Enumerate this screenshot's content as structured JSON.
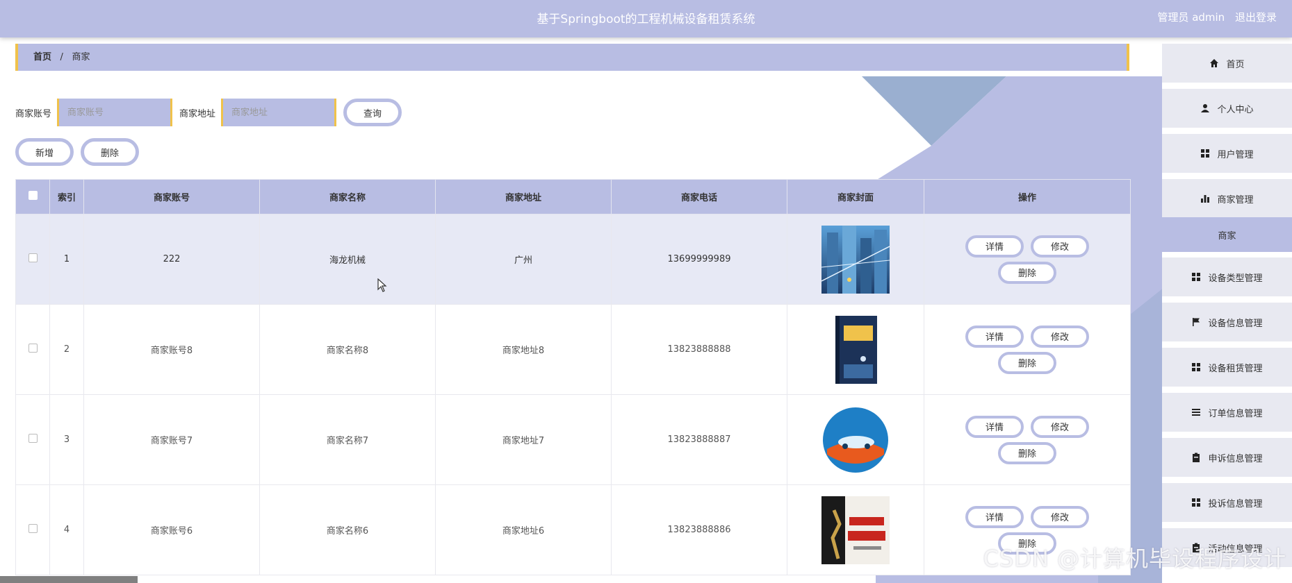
{
  "header": {
    "title": "基于Springboot的工程机械设备租赁系统",
    "role_user": "管理员 admin",
    "logout": "退出登录"
  },
  "breadcrumb": {
    "home": "首页",
    "sep": "/",
    "current": "商家"
  },
  "search": {
    "account_label": "商家账号",
    "account_placeholder": "商家账号",
    "address_label": "商家地址",
    "address_placeholder": "商家地址",
    "query_button": "查询"
  },
  "actions": {
    "add": "新增",
    "delete": "删除"
  },
  "table": {
    "columns": [
      "索引",
      "商家账号",
      "商家名称",
      "商家地址",
      "商家电话",
      "商家封面",
      "操作"
    ],
    "rows": [
      {
        "index": "1",
        "account": "222",
        "name": "海龙机械",
        "address": "广州",
        "phone": "13699999989",
        "cover": "city-buildings-image"
      },
      {
        "index": "2",
        "account": "商家账号8",
        "name": "商家名称8",
        "address": "商家地址8",
        "phone": "13823888888",
        "cover": "book-cover-image"
      },
      {
        "index": "3",
        "account": "商家账号7",
        "name": "商家名称7",
        "address": "商家地址7",
        "phone": "13823888887",
        "cover": "car-insurance-logo"
      },
      {
        "index": "4",
        "account": "商家账号6",
        "name": "商家名称6",
        "address": "商家地址6",
        "phone": "13823888886",
        "cover": "pingan-poster-image"
      }
    ],
    "op_detail": "详情",
    "op_edit": "修改",
    "op_delete": "删除"
  },
  "sidebar": {
    "items": [
      {
        "label": "首页",
        "icon": "home-icon"
      },
      {
        "label": "个人中心",
        "icon": "user-icon"
      },
      {
        "label": "用户管理",
        "icon": "grid-icon"
      },
      {
        "label": "商家管理",
        "icon": "bar-chart-icon"
      },
      {
        "label": "商家",
        "icon": ""
      },
      {
        "label": "设备类型管理",
        "icon": "grid-icon"
      },
      {
        "label": "设备信息管理",
        "icon": "flag-icon"
      },
      {
        "label": "设备租赁管理",
        "icon": "grid-icon"
      },
      {
        "label": "订单信息管理",
        "icon": "list-icon"
      },
      {
        "label": "申诉信息管理",
        "icon": "clipboard-icon"
      },
      {
        "label": "投诉信息管理",
        "icon": "grid-icon"
      },
      {
        "label": "活动信息管理",
        "icon": "clipboard-icon"
      }
    ]
  },
  "watermark": "CSDN @计算机毕设程序设计",
  "colors": {
    "accent": "#b8bde3",
    "highlight": "#f0c24b",
    "row_hover": "#e7e9f5"
  }
}
